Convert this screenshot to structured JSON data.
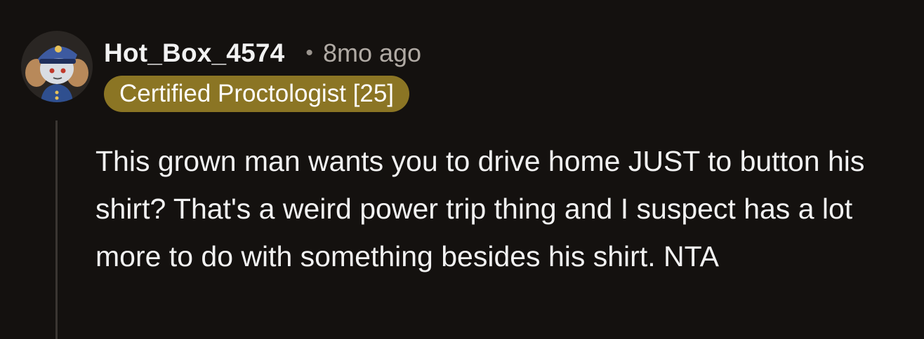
{
  "comment": {
    "author": "Hot_Box_4574",
    "separator": "•",
    "timestamp": "8mo ago",
    "flair": "Certified Proctologist [25]",
    "body": "This grown man wants you to drive home JUST to button his shirt? That's a weird power trip thing and I suspect has a lot more to do with something besides his shirt. NTA",
    "avatar_icon": "snoo-police-avatar",
    "colors": {
      "background": "#14110f",
      "flair_background": "#8b7524",
      "text": "#f2f2f2",
      "meta_text": "#b0aaa4",
      "thread_line": "#3a3632"
    }
  }
}
